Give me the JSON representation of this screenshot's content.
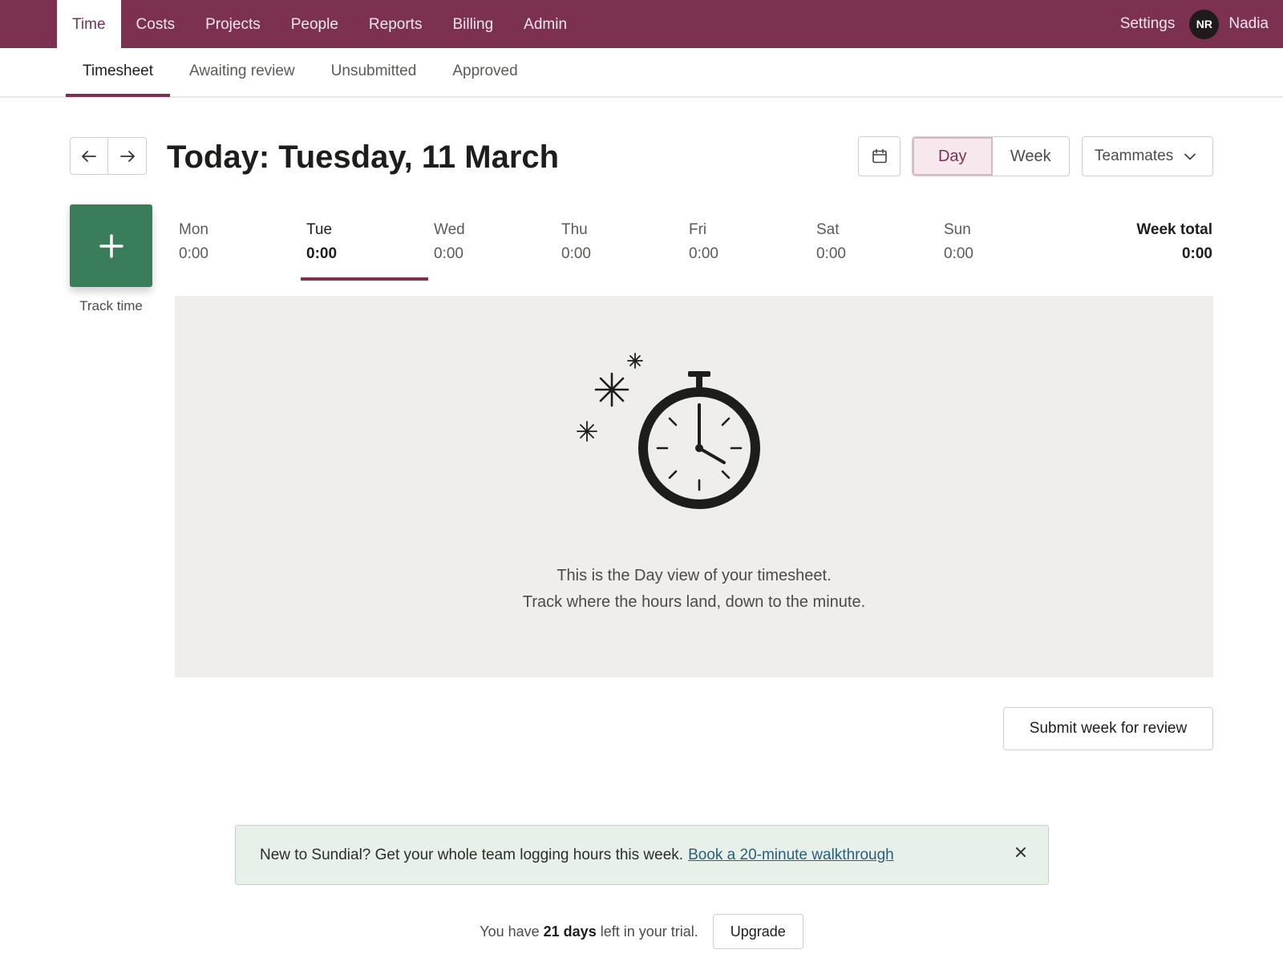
{
  "topnav": {
    "items": [
      "Time",
      "Costs",
      "Projects",
      "People",
      "Reports",
      "Billing",
      "Admin"
    ],
    "active": "Time",
    "settings_label": "Settings",
    "user_initials": "NR",
    "user_name": "Nadia"
  },
  "subnav": {
    "tabs": [
      "Timesheet",
      "Awaiting review",
      "Unsubmitted",
      "Approved"
    ],
    "active": "Timesheet"
  },
  "header": {
    "today_label": "Today:",
    "date": "Tuesday, 11 March",
    "icons": {
      "prev": "arrow-left-icon",
      "next": "arrow-right-icon",
      "calendar": "calendar-icon"
    },
    "view_options": [
      "Day",
      "Week"
    ],
    "active_view": "Day",
    "teammates_label": "Teammates"
  },
  "track": {
    "label": "Track time",
    "icon": "plus-icon"
  },
  "days": [
    {
      "name": "Mon",
      "value": "0:00"
    },
    {
      "name": "Tue",
      "value": "0:00"
    },
    {
      "name": "Wed",
      "value": "0:00"
    },
    {
      "name": "Thu",
      "value": "0:00"
    },
    {
      "name": "Fri",
      "value": "0:00"
    },
    {
      "name": "Sat",
      "value": "0:00"
    },
    {
      "name": "Sun",
      "value": "0:00"
    }
  ],
  "active_day": "Tue",
  "week_total": {
    "label": "Week total",
    "value": "0:00"
  },
  "empty_state": {
    "icon": "stopwatch-icon",
    "line1": "This is the Day view of your timesheet.",
    "line2": "Track where the hours land, down to the minute."
  },
  "submit_label": "Submit week for review",
  "banner": {
    "text": "New to Sundial? Get your whole team logging hours this week.",
    "link": "Book a 20-minute walkthrough"
  },
  "trial": {
    "prefix": "You have",
    "days": "21 days",
    "suffix": "left in your trial.",
    "upgrade_label": "Upgrade"
  },
  "colors": {
    "brand": "#7c3150",
    "track_button": "#3a7d5a",
    "panel": "#efeeec",
    "banner": "#e7f1ea"
  }
}
